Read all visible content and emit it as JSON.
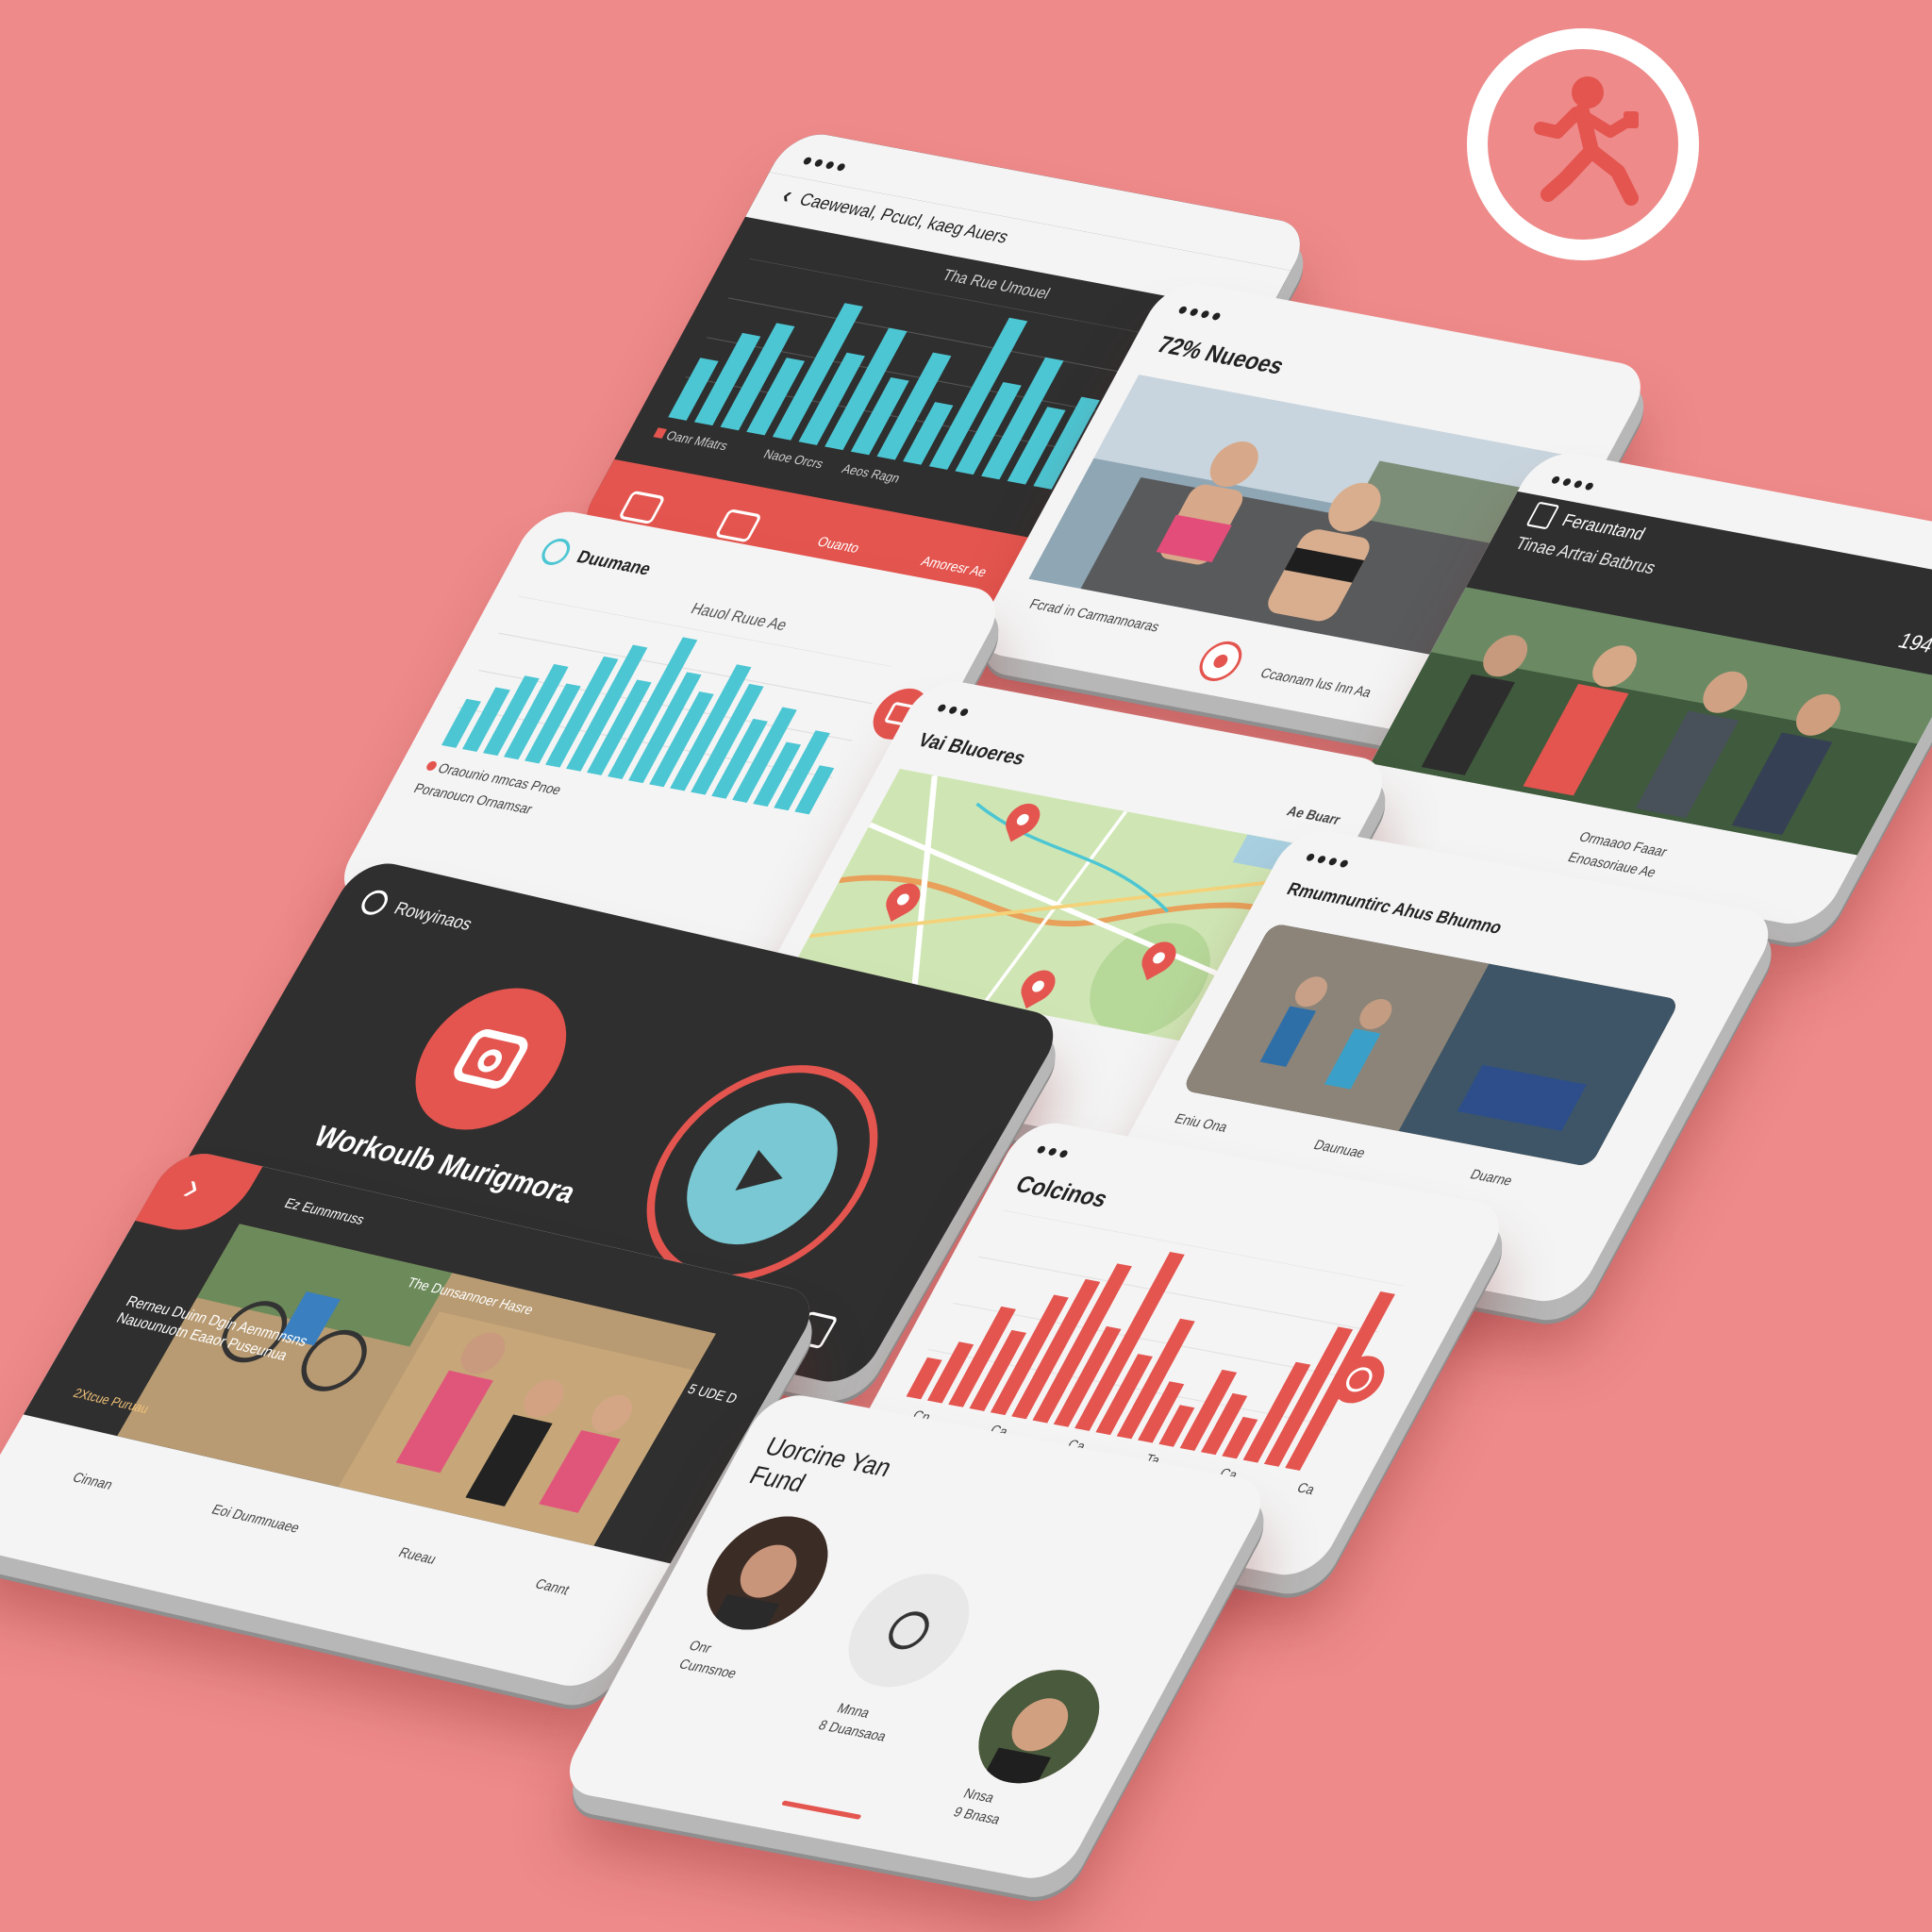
{
  "colors": {
    "background": "#ee8a8a",
    "accent": "#e4554f",
    "dark": "#2f2f2f",
    "teal": "#4cc6d3",
    "light": "#f4f4f4"
  },
  "logo": {
    "icon": "running-person-icon"
  },
  "screens": {
    "dark_chart": {
      "header": "Caewewal, Pcucl, kaeg Auers",
      "chart_title": "Tha Rue Umouel",
      "legend": "Oanr Mfatrs",
      "tab_label": "Ouanto",
      "foot_a": "Naoe Orcrs",
      "foot_b": "Aeos Ragn",
      "foot_c": "Amoresr Ae"
    },
    "photo_women": {
      "title": "72% Nueoes",
      "caption": "Fcrad in Carmannoaras",
      "footer": "Ccaonam lus Inn Aa"
    },
    "trail_group": {
      "title": "Ferauntand",
      "subtitle": "Tinae Artrai Batbrus",
      "count": "194",
      "footer": "Ormaaoo Faaar",
      "footer_b": "Enoasoriaue Ae"
    },
    "light_chart": {
      "title": "Duumane",
      "chart_title": "Hauol Ruue Ae",
      "legend": "Oraounio nmcas Pnoe",
      "foot": "Poranoucn Ornamsar"
    },
    "map": {
      "title": "Vai Bluoeres",
      "corner": "Ae Buarr"
    },
    "videos": {
      "title": "Rmumnuntirc Ahus Bhumno",
      "foot_a": "Eniu Ona",
      "foot_b": "Daunuae",
      "foot_c": "Duarne"
    },
    "workout": {
      "header": "Rowyinaos",
      "title": "Workoulb Murigmora"
    },
    "bottom_left": {
      "header": "Ez Eunnmruss",
      "subheader": "The Dunsannoer Hasre",
      "time": "5 UDE D",
      "caption": "Rerneu Duinn Dgin Aenmnnsns Nauounuotn Eaaor Puseunua",
      "tagline": "2Xtcue Puruau",
      "foot": "Cinnan",
      "foot_b": "Eoi Dunmnuaee",
      "foot_c": "Rueau",
      "foot_d": "Cannt"
    },
    "calories": {
      "title": "Colcinos",
      "ticks": [
        "Cn",
        "Ca",
        "Ca",
        "Ta",
        "Ca",
        "Ca"
      ]
    },
    "friends": {
      "title": "Uorcine Yan Fund",
      "p1_name": "Onr",
      "p1_meta": "Cunnsnoe",
      "center_label": "Mnna",
      "center_meta": "8 Duansaoa",
      "p2_name": "Nnsa",
      "p2_meta": "9 Bnasa"
    }
  },
  "chart_data": [
    {
      "type": "bar",
      "title": "Tha Rue Umouel",
      "values": [
        4,
        6,
        7,
        5,
        9,
        6,
        8,
        5,
        7,
        4,
        10,
        6,
        8,
        5,
        6,
        4,
        7,
        5
      ]
    },
    {
      "type": "bar",
      "title": "Hauol Ruue Ae",
      "values": [
        3,
        4,
        5,
        6,
        5,
        7,
        8,
        6,
        9,
        7,
        6,
        8,
        7,
        5,
        6,
        4,
        5,
        3
      ]
    },
    {
      "type": "bar",
      "title": "Colcinos",
      "values": [
        2,
        3,
        5,
        4,
        6,
        7,
        8,
        5,
        9,
        4,
        6,
        3,
        2,
        4,
        3,
        2,
        5,
        7,
        9
      ]
    }
  ]
}
